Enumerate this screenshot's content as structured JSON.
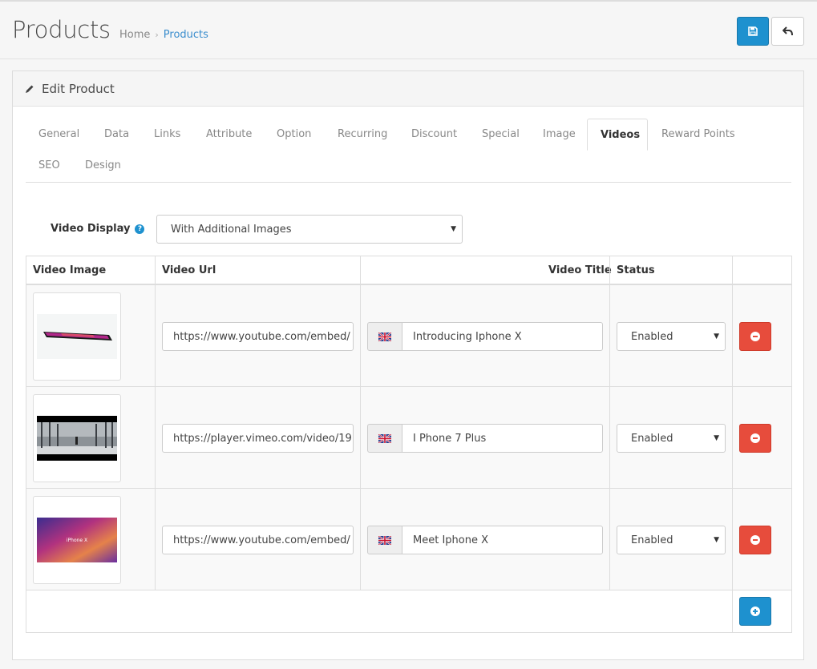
{
  "header": {
    "title": "Products",
    "breadcrumb": [
      {
        "label": "Home"
      },
      {
        "label": "Products"
      }
    ],
    "breadcrumb_sep": "›"
  },
  "panel": {
    "title": "Edit Product"
  },
  "tabs": [
    {
      "label": "General"
    },
    {
      "label": "Data"
    },
    {
      "label": "Links"
    },
    {
      "label": "Attribute"
    },
    {
      "label": "Option"
    },
    {
      "label": "Recurring"
    },
    {
      "label": "Discount"
    },
    {
      "label": "Special"
    },
    {
      "label": "Image"
    },
    {
      "label": "Videos",
      "active": true
    },
    {
      "label": "Reward Points"
    },
    {
      "label": "SEO"
    },
    {
      "label": "Design"
    }
  ],
  "video_display": {
    "label": "Video Display",
    "help": "?",
    "value": "With Additional Images"
  },
  "table": {
    "headers": {
      "image": "Video Image",
      "url": "Video Url",
      "title": "Video Title",
      "status": "Status"
    },
    "rows": [
      {
        "url": "https://www.youtube.com/embed/",
        "title": "Introducing Iphone X",
        "status": "Enabled",
        "thumb": "phone"
      },
      {
        "url": "https://player.vimeo.com/video/19",
        "title": "I Phone 7 Plus",
        "status": "Enabled",
        "thumb": "street"
      },
      {
        "url": "https://www.youtube.com/embed/",
        "title": "Meet Iphone X",
        "status": "Enabled",
        "thumb": "gradient",
        "thumb_text": "iPhone X"
      }
    ]
  },
  "colors": {
    "primary": "#1e91cf",
    "danger": "#e74c3c",
    "link": "#3a8dcd"
  }
}
